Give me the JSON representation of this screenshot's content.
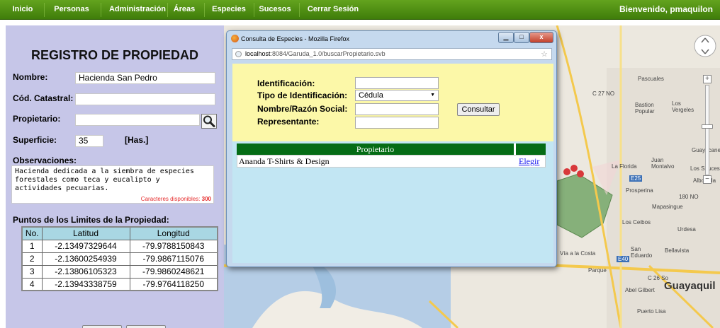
{
  "nav": {
    "items": [
      "Inicio",
      "Personas",
      "Administración",
      "Áreas",
      "Especies",
      "Sucesos",
      "Cerrar Sesión"
    ],
    "welcome": "Bienvenido, pmaquilon"
  },
  "form": {
    "title": "REGISTRO DE PROPIEDAD",
    "nombre_label": "Nombre:",
    "nombre_value": "Hacienda San Pedro",
    "cod_label": "Cód. Catastral:",
    "cod_value": "",
    "propietario_label": "Propietario:",
    "propietario_value": "",
    "superficie_label": "Superficie:",
    "superficie_value": "35",
    "superficie_unit": "[Has.]",
    "obs_label": "Observaciones:",
    "obs_value": "Hacienda dedicada a la siembra de especies forestales como teca y eucalipto y actividades pecuarias.",
    "chars_label": "Caracteres disponibles:",
    "chars_value": "300",
    "points_title": "Puntos de los Limites de la Propiedad:",
    "points_headers": [
      "No.",
      "Latitud",
      "Longitud"
    ],
    "points": [
      [
        "1",
        "-2.13497329644",
        "-79.9788150843"
      ],
      [
        "2",
        "-2.13600254939",
        "-79.9867115076"
      ],
      [
        "3",
        "-2.13806105323",
        "-79.9860248621"
      ],
      [
        "4",
        "-2.13943338759",
        "-79.9764118250"
      ]
    ]
  },
  "popup": {
    "title": "Consulta de Especies - Mozilla Firefox",
    "url_host": "localhost",
    "url_rest": ":8084/Garuda_1.0/buscarPropietario.svb",
    "id_label": "Identificación:",
    "tipo_label": "Tipo de Identificación:",
    "tipo_value": "Cédula",
    "nombre_label": "Nombre/Razón Social:",
    "rep_label": "Representante:",
    "consult_label": "Consultar",
    "result_header": "Propietario",
    "result_name": "Ananda T-Shirts & Design",
    "result_action": "Elegir"
  },
  "map": {
    "labels": [
      "Pascuales",
      "Bastion Popular",
      "Los Vergeles",
      "La Florida",
      "Juan Montalvo",
      "Los Sauces",
      "Prosperina",
      "Mapasingue",
      "Los Ceibos",
      "Urdesa",
      "San Eduardo",
      "Bellavista",
      "Abel Gilbert",
      "Guayaquil",
      "Puerto Lisa",
      "Guayacanes",
      "Alborada",
      "Parque",
      "Vía a la Costa",
      "E40",
      "E25",
      "C 27 NO",
      "C 26 So",
      "180 NO"
    ]
  }
}
